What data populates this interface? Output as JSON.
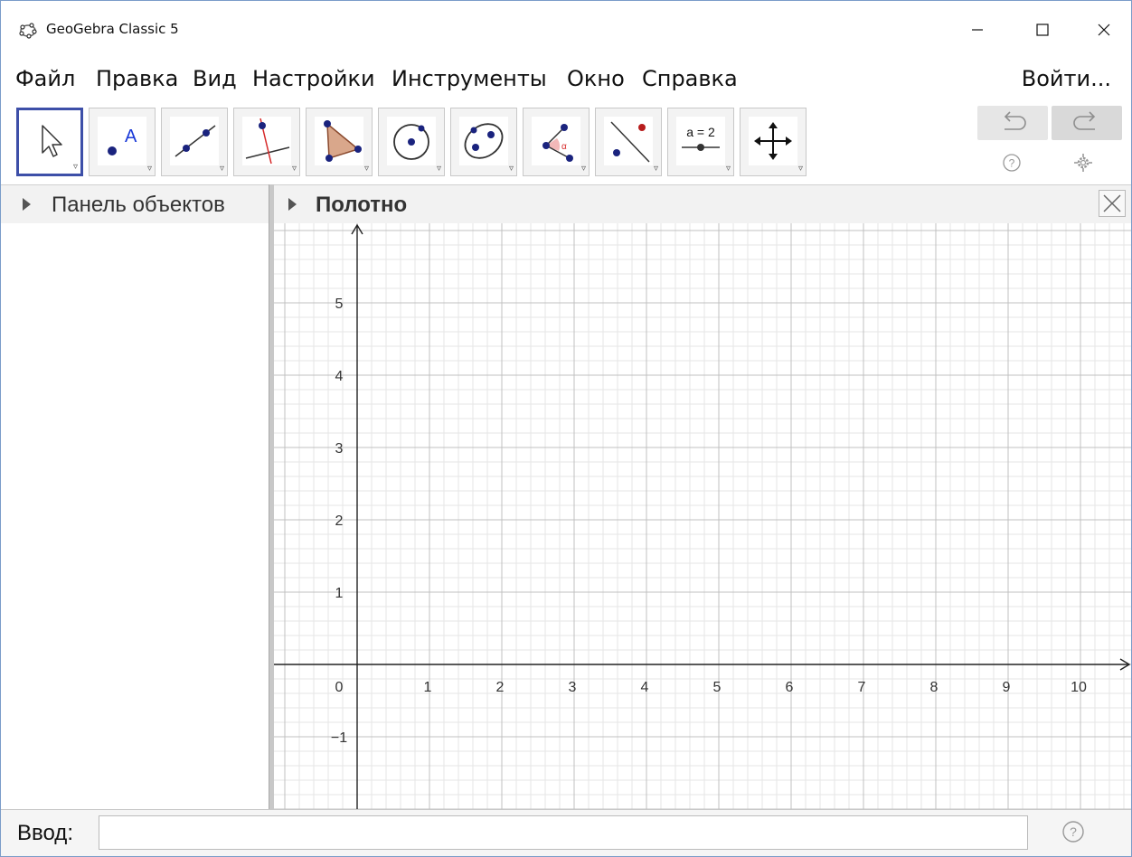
{
  "window": {
    "title": "GeoGebra Classic 5"
  },
  "menu": {
    "items": [
      "Файл",
      "Правка",
      "Вид",
      "Настройки",
      "Инструменты",
      "Окно",
      "Справка"
    ],
    "login": "Войти..."
  },
  "toolbar": {
    "tools": [
      {
        "name": "move-tool",
        "icon": "arrow-cursor-icon"
      },
      {
        "name": "point-tool",
        "icon": "point-icon",
        "label": "A"
      },
      {
        "name": "line-tool",
        "icon": "line-through-two-points-icon"
      },
      {
        "name": "perpendicular-line-tool",
        "icon": "perpendicular-line-icon"
      },
      {
        "name": "polygon-tool",
        "icon": "polygon-icon"
      },
      {
        "name": "circle-tool",
        "icon": "circle-with-center-icon"
      },
      {
        "name": "ellipse-tool",
        "icon": "ellipse-icon"
      },
      {
        "name": "angle-tool",
        "icon": "angle-icon",
        "label": "α"
      },
      {
        "name": "reflect-tool",
        "icon": "reflect-about-line-icon"
      },
      {
        "name": "slider-tool",
        "icon": "slider-icon",
        "label": "a = 2"
      },
      {
        "name": "move-graphics-tool",
        "icon": "move-graphics-icon"
      }
    ]
  },
  "panels": {
    "algebra_title": "Панель объектов",
    "graphics_title": "Полотно"
  },
  "graphics": {
    "x_labels": [
      "0",
      "1",
      "2",
      "3",
      "4",
      "5",
      "6",
      "7",
      "8",
      "9",
      "10"
    ],
    "y_labels": [
      "5",
      "4",
      "3",
      "2",
      "1",
      "−1"
    ],
    "grid": true
  },
  "input": {
    "label": "Ввод:",
    "value": ""
  },
  "colors": {
    "selected_tool_border": "#3d4fa8",
    "point": "#1a237e",
    "grid_major": "#c0c0c0",
    "grid_minor": "#e6e6e6"
  }
}
